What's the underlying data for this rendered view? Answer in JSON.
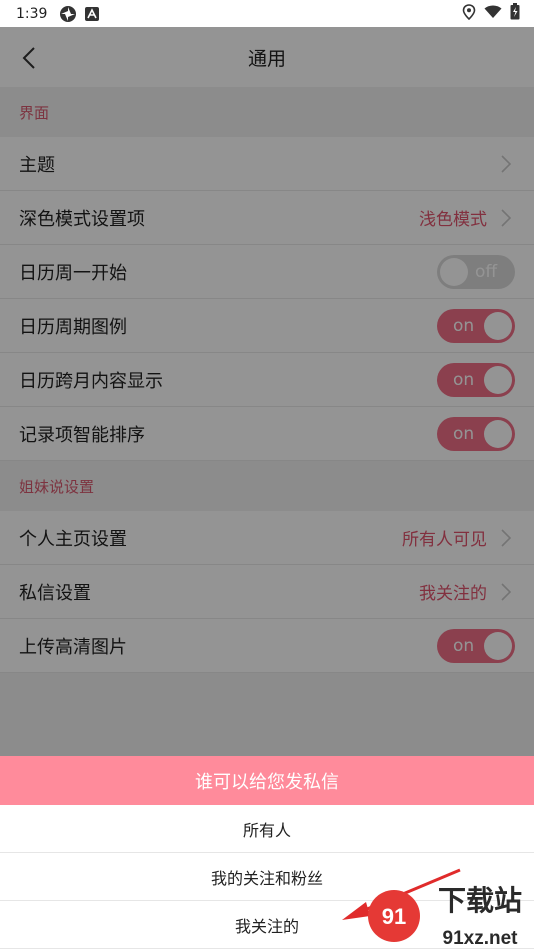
{
  "status_bar": {
    "time": "1:39",
    "icons_left": [
      "pinwheel-icon",
      "a-badge-icon"
    ],
    "icons_right": [
      "location-icon",
      "wifi-icon",
      "battery-icon"
    ]
  },
  "app_bar": {
    "title": "通用",
    "back_icon": "chevron-left-icon"
  },
  "sections": [
    {
      "header": "界面",
      "rows": [
        {
          "label": "主题",
          "type": "link",
          "value": ""
        },
        {
          "label": "深色模式设置项",
          "type": "link",
          "value": "浅色模式"
        },
        {
          "label": "日历周一开始",
          "type": "toggle",
          "state": "off",
          "state_text": "off"
        },
        {
          "label": "日历周期图例",
          "type": "toggle",
          "state": "on",
          "state_text": "on"
        },
        {
          "label": "日历跨月内容显示",
          "type": "toggle",
          "state": "on",
          "state_text": "on"
        },
        {
          "label": "记录项智能排序",
          "type": "toggle",
          "state": "on",
          "state_text": "on"
        }
      ]
    },
    {
      "header": "姐妹说设置",
      "rows": [
        {
          "label": "个人主页设置",
          "type": "link",
          "value": "所有人可见"
        },
        {
          "label": "私信设置",
          "type": "link",
          "value": "我关注的"
        },
        {
          "label": "上传高清图片",
          "type": "toggle",
          "state": "on",
          "state_text": "on"
        }
      ]
    }
  ],
  "bottom_sheet": {
    "title": "谁可以给您发私信",
    "options": [
      "所有人",
      "我的关注和粉丝",
      "我关注的"
    ]
  },
  "watermark": {
    "text_top": "下载站",
    "text_bottom": "91xz.net"
  },
  "colors": {
    "accent": "#e0546d",
    "toggle_on": "#ef6f87",
    "toggle_off": "#d9d9d9",
    "sheet_title_bg": "#ff8b9b",
    "arrow": "#e02b2b"
  }
}
